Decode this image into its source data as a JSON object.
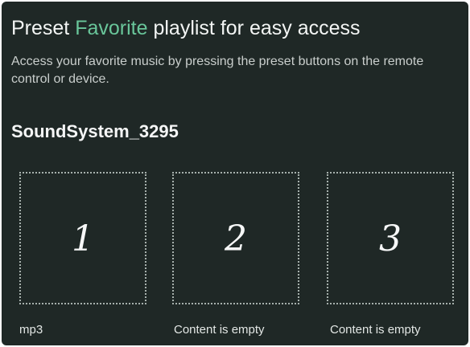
{
  "header": {
    "title_before": "Preset ",
    "title_accent": "Favorite",
    "title_after": " playlist for easy access",
    "description": "Access your favorite music by pressing the preset buttons on the remote control or device."
  },
  "device": {
    "name": "SoundSystem_3295"
  },
  "presets": [
    {
      "number": "1",
      "label": "mp3"
    },
    {
      "number": "2",
      "label": "Content is empty"
    },
    {
      "number": "3",
      "label": "Content is empty"
    }
  ],
  "colors": {
    "background": "#1f2826",
    "accent": "#69c69a",
    "text": "#f1f3f2",
    "dotted_border": "#a7b1ad"
  }
}
